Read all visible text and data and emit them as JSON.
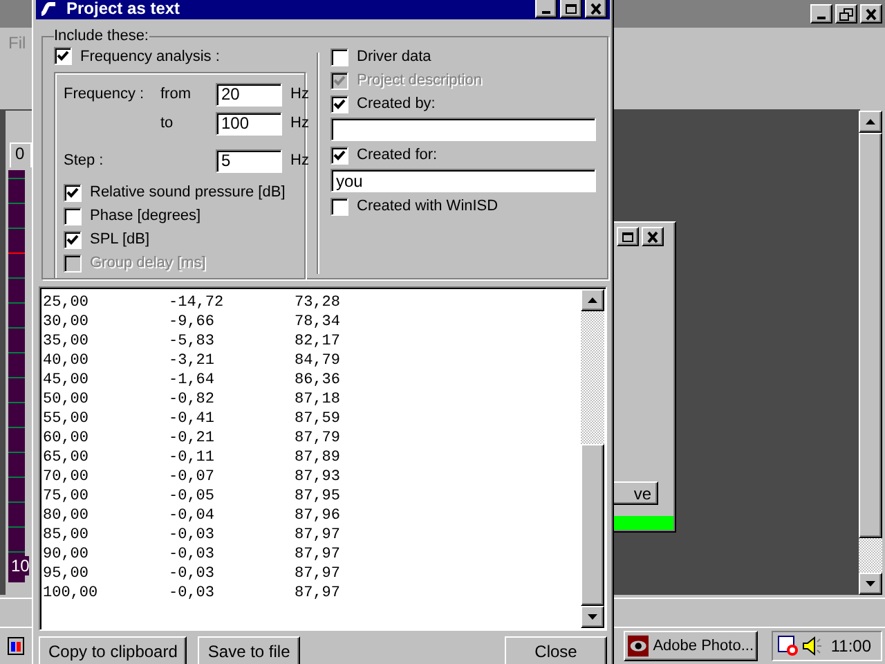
{
  "background_app": {
    "menu_item": "Fil",
    "tab_label": "0",
    "axis_label": "10",
    "child_button": "ve",
    "progress": {
      "level": 1
    }
  },
  "dialog": {
    "title": "Project as text",
    "group_label": "Include these:",
    "frequency_analysis": {
      "label": "Frequency analysis :",
      "checked": true,
      "disabled": false
    },
    "frequency_rows": [
      {
        "label": "Frequency :",
        "sublabel": "from",
        "value": "20",
        "unit": "Hz"
      },
      {
        "label": "",
        "sublabel": "to",
        "value": "100",
        "unit": "Hz"
      },
      {
        "label": "Step :",
        "sublabel": "",
        "value": "5",
        "unit": "Hz"
      }
    ],
    "quantities": [
      {
        "label": "Relative sound pressure [dB]",
        "checked": true,
        "disabled": false
      },
      {
        "label": "Phase [degrees]",
        "checked": false,
        "disabled": false
      },
      {
        "label": "SPL [dB]",
        "checked": true,
        "disabled": false
      },
      {
        "label": "Group delay [ms]",
        "checked": false,
        "disabled": true
      }
    ],
    "right_items": [
      {
        "kind": "checkbox",
        "label": "Driver data",
        "checked": false,
        "disabled": false
      },
      {
        "kind": "checkbox",
        "label": "Project description",
        "checked": true,
        "disabled": true
      },
      {
        "kind": "checkbox",
        "label": "Created by:",
        "checked": true,
        "disabled": false
      },
      {
        "kind": "field",
        "value": ""
      },
      {
        "kind": "checkbox",
        "label": "Created for:",
        "checked": true,
        "disabled": false
      },
      {
        "kind": "field",
        "value": "you"
      },
      {
        "kind": "checkbox",
        "label": "Created with WinISD",
        "checked": false,
        "disabled": false
      }
    ],
    "output_rows": [
      [
        "25,00",
        "-14,72",
        "73,28"
      ],
      [
        "30,00",
        "-9,66",
        "78,34"
      ],
      [
        "35,00",
        "-5,83",
        "82,17"
      ],
      [
        "40,00",
        "-3,21",
        "84,79"
      ],
      [
        "45,00",
        "-1,64",
        "86,36"
      ],
      [
        "50,00",
        "-0,82",
        "87,18"
      ],
      [
        "55,00",
        "-0,41",
        "87,59"
      ],
      [
        "60,00",
        "-0,21",
        "87,79"
      ],
      [
        "65,00",
        "-0,11",
        "87,89"
      ],
      [
        "70,00",
        "-0,07",
        "87,93"
      ],
      [
        "75,00",
        "-0,05",
        "87,95"
      ],
      [
        "80,00",
        "-0,04",
        "87,96"
      ],
      [
        "85,00",
        "-0,03",
        "87,97"
      ],
      [
        "90,00",
        "-0,03",
        "87,97"
      ],
      [
        "95,00",
        "-0,03",
        "87,97"
      ],
      [
        "100,00",
        "-0,03",
        "87,97"
      ]
    ],
    "buttons": [
      "Copy to clipboard",
      "Save to file",
      "Close"
    ]
  },
  "taskbar": {
    "item": "Adobe Photo...",
    "clock": "11:00"
  }
}
